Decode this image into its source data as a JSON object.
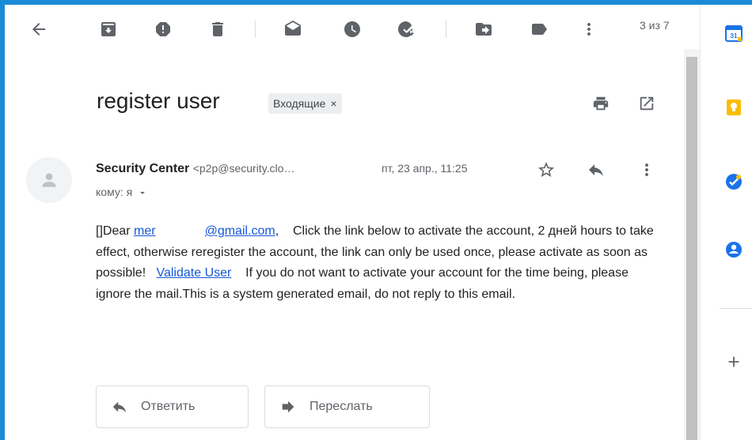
{
  "toolbar": {
    "counter": "3 из 7",
    "icons": [
      "back-arrow-icon",
      "archive-icon",
      "report-spam-icon",
      "delete-icon",
      "mark-unread-icon",
      "snooze-icon",
      "add-to-tasks-icon",
      "move-to-icon",
      "label-icon",
      "more-vert-icon"
    ]
  },
  "subject": {
    "title": "register user",
    "label": "Входящие",
    "label_remove": "×"
  },
  "sender": {
    "name": "Security Center",
    "email": "<p2p@security.clo…",
    "date": "пт, 23 апр., 11:25",
    "to": "кому: я"
  },
  "body": {
    "p1": "[]Dear ",
    "link1": "mer",
    "link1b": "@gmail.com",
    "p2": ",    Click the link below to activate the account, 2 дней hours to take effect, otherwise reregister the account, the link can only be used once, please activate as soon as possible!   ",
    "link2": "Validate User",
    "p3": "    If you do not want to activate your account for the time being, please ignore the mail.This is a system generated email, do not reply to this email."
  },
  "actions": {
    "reply": "Ответить",
    "forward": "Переслать"
  },
  "rail": {
    "calendar_day": "31"
  },
  "colors": {
    "frame": "#1a8bd6",
    "link": "#1558d6",
    "calendar": "#1a73e8",
    "keep": "#fbbc04",
    "tasks": "#1a73e8",
    "contacts": "#1a73e8"
  }
}
